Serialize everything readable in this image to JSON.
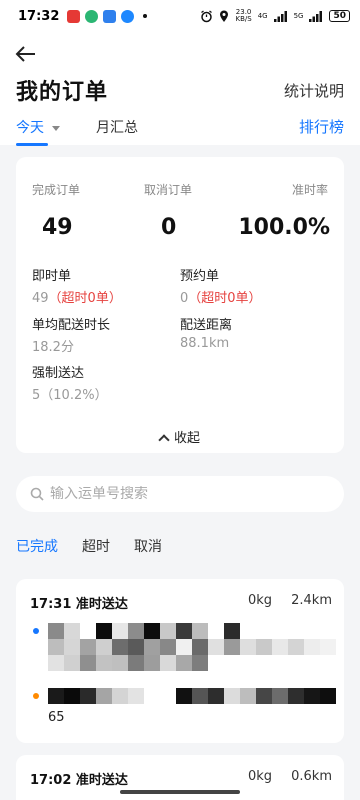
{
  "status_bar": {
    "time": "17:32",
    "net_speed_value": "23.0",
    "net_speed_unit": "KB/S",
    "network_type": "4G",
    "network_type_2": "5G",
    "battery": "50"
  },
  "header": {
    "title": "我的订单",
    "stats_link": "统计说明",
    "tabs": {
      "today": "今天",
      "month": "月汇总"
    },
    "rank_link": "排行榜"
  },
  "summary": {
    "metrics": [
      {
        "label": "完成订单",
        "value": "49"
      },
      {
        "label": "取消订单",
        "value": "0"
      },
      {
        "label": "准时率",
        "value": "100.0%"
      }
    ],
    "instant": {
      "label": "即时单",
      "count": "49",
      "overtime": "（超时0单）"
    },
    "reserved": {
      "label": "预约单",
      "count": "0",
      "overtime": "（超时0单）"
    },
    "avg_time": {
      "label": "单均配送时长",
      "value": "18.2分"
    },
    "distance": {
      "label": "配送距离",
      "value": "88.1km"
    },
    "forced": {
      "label": "强制送达",
      "value": "5（10.2%）"
    },
    "collapse_label": "收起"
  },
  "search": {
    "placeholder": "输入运单号搜索"
  },
  "filters": [
    "已完成",
    "超时",
    "取消"
  ],
  "orders": [
    {
      "time": "17:31 准时送达",
      "weight": "0kg",
      "distance": "2.4km",
      "fragment": "65"
    },
    {
      "time": "17:02 准时送达",
      "weight": "0kg",
      "distance": "0.6km"
    }
  ],
  "colors": {
    "accent": "#1677ff",
    "warning": "#e64340",
    "pickup_dot": "#1677ff",
    "dropoff_dot": "#ff8a00"
  }
}
